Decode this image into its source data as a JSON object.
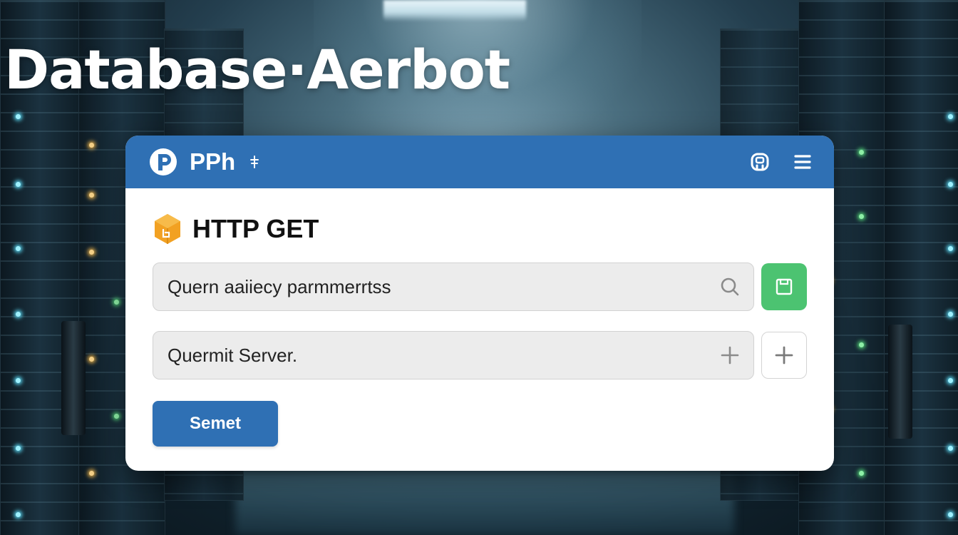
{
  "headline": "Database·Aerbot",
  "window": {
    "app_name": "PPh",
    "title_icons": [
      "app-logo-icon",
      "pin-icon",
      "robot-icon",
      "hamburger-menu-icon"
    ]
  },
  "request": {
    "method_label": "HTTP GET",
    "method_icon": "package-box-icon",
    "query_field": {
      "placeholder": "Quern aaiiecy parmmerrtss",
      "value": "",
      "inline_icon": "search-icon",
      "side_button_icon": "save-icon"
    },
    "server_field": {
      "placeholder": "Quermit Server.",
      "value": "",
      "inline_icon": "plus-icon",
      "side_button_icon": "plus-icon"
    },
    "submit_label": "Semet"
  },
  "colors": {
    "titlebar": "#2f70b4",
    "submit_button": "#2f70b4",
    "save_button": "#4cc371",
    "box_icon": "#f2a122",
    "background": "#243f4f"
  }
}
